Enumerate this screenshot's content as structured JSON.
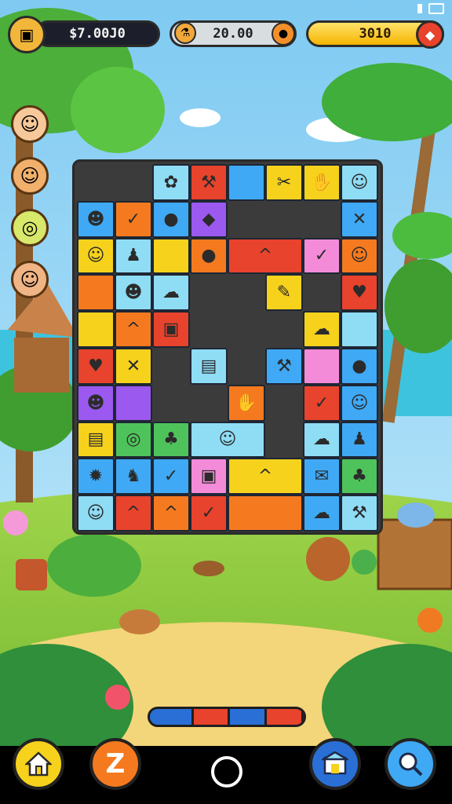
{
  "hud": {
    "coins": "$7.00J0",
    "energy": "20.00",
    "gold": "3010"
  },
  "bottom_nav": {
    "home_icon": "house-icon",
    "z_label": "Z",
    "shop_icon": "shop-icon",
    "search_icon": "search-icon"
  },
  "board_colors": {
    "blue": "#3fa9f5",
    "orange": "#f57a1f",
    "yellow": "#f7d21c",
    "purple": "#9b59f0",
    "pink": "#f48bd8",
    "red": "#e8432c",
    "green": "#4fc35b",
    "lightblue": "#8fdcf5"
  },
  "progress": {
    "segments": [
      "#2a6fd6",
      "#e8432c",
      "#2a6fd6",
      "#e8432c"
    ]
  }
}
